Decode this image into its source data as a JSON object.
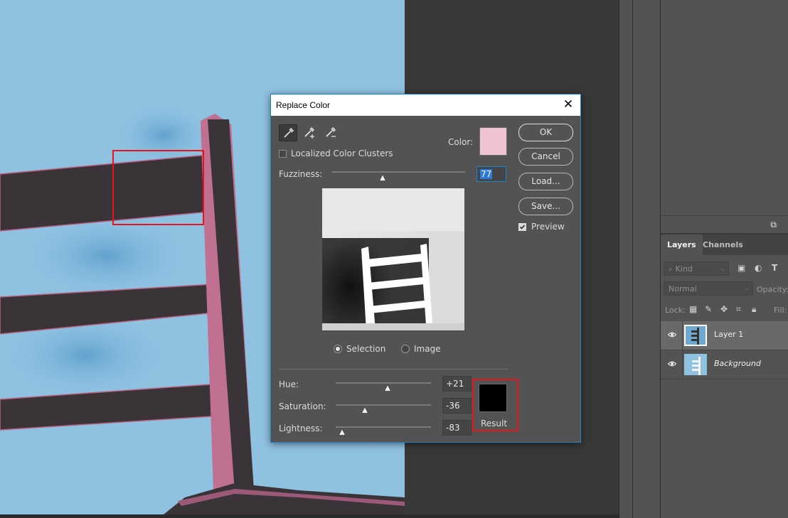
{
  "dialog": {
    "title": "Replace Color",
    "color_label": "Color:",
    "localized_clusters_label": "Localized Color Clusters",
    "localized_clusters_checked": false,
    "fuzziness_label": "Fuzziness:",
    "fuzziness_value": "77",
    "view_options": [
      "Selection",
      "Image"
    ],
    "selected_view": "Selection",
    "hue_label": "Hue:",
    "hue_value": "+21",
    "saturation_label": "Saturation:",
    "saturation_value": "-36",
    "lightness_label": "Lightness:",
    "lightness_value": "-83",
    "result_label": "Result",
    "color_swatch": "#efc3d1",
    "result_swatch": "#000000",
    "buttons": {
      "ok": "OK",
      "cancel": "Cancel",
      "load": "Load...",
      "save": "Save..."
    },
    "preview_label": "Preview",
    "preview_checked": true
  },
  "layers_panel": {
    "tabs": [
      "Layers",
      "Channels"
    ],
    "active_tab": "Layers",
    "filter_kind": "Kind",
    "blend_mode": "Normal",
    "opacity_label": "Opacity:",
    "lock_label": "Lock:",
    "fill_label": "Fill:",
    "layers": [
      {
        "name": "Layer 1",
        "selected": true,
        "italic": false
      },
      {
        "name": "Background",
        "selected": false,
        "italic": true
      }
    ]
  },
  "colors": {
    "wall": "#8fc1e1",
    "chair": "#3a3438",
    "chair_edge": "#b5607f",
    "highlight_red": "#e8141b",
    "dialog_accent": "#1d84c7"
  }
}
